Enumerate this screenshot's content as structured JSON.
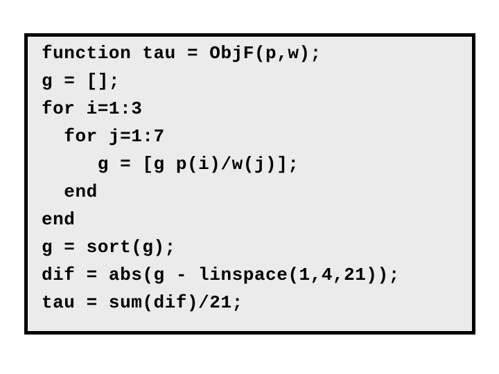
{
  "document": {
    "kind": "code-listing",
    "language": "MATLAB",
    "function_name": "ObjF",
    "background_color": "#ffffff",
    "box_background_color": "#ebebeb",
    "box_border_color": "#000000",
    "text_color": "#000000"
  },
  "code": {
    "lines": [
      {
        "indent": 0,
        "text": "function tau = ObjF(p,w);"
      },
      {
        "indent": 0,
        "text": "g = [];"
      },
      {
        "indent": 0,
        "text": "for i=1:3"
      },
      {
        "indent": 2,
        "text": "  for j=1:7"
      },
      {
        "indent": 5,
        "text": "     g = [g p(i)/w(j)];"
      },
      {
        "indent": 2,
        "text": "  end"
      },
      {
        "indent": 0,
        "text": "end"
      },
      {
        "indent": 0,
        "text": "g = sort(g);"
      },
      {
        "indent": 0,
        "text": "dif = abs(g - linspace(1,4,21));"
      },
      {
        "indent": 0,
        "text": "tau = sum(dif)/21;"
      }
    ]
  }
}
